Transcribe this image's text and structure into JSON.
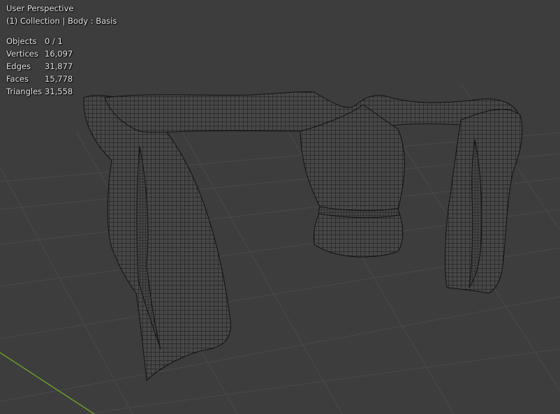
{
  "viewport": {
    "title": "User Perspective",
    "collection": "(1) Collection | Body : Basis"
  },
  "stats": [
    {
      "label": "Objects",
      "value": "0 / 1"
    },
    {
      "label": "Vertices",
      "value": "16,097"
    },
    {
      "label": "Edges",
      "value": "31,877"
    },
    {
      "label": "Faces",
      "value": "15,778"
    },
    {
      "label": "Triangles",
      "value": "31,558"
    }
  ],
  "colors": {
    "background": "#3d3d3d",
    "grid": "#4a4a4a",
    "y_axis": "#6a9a2a",
    "mesh_fill": "#474747",
    "wire": "#141414"
  }
}
